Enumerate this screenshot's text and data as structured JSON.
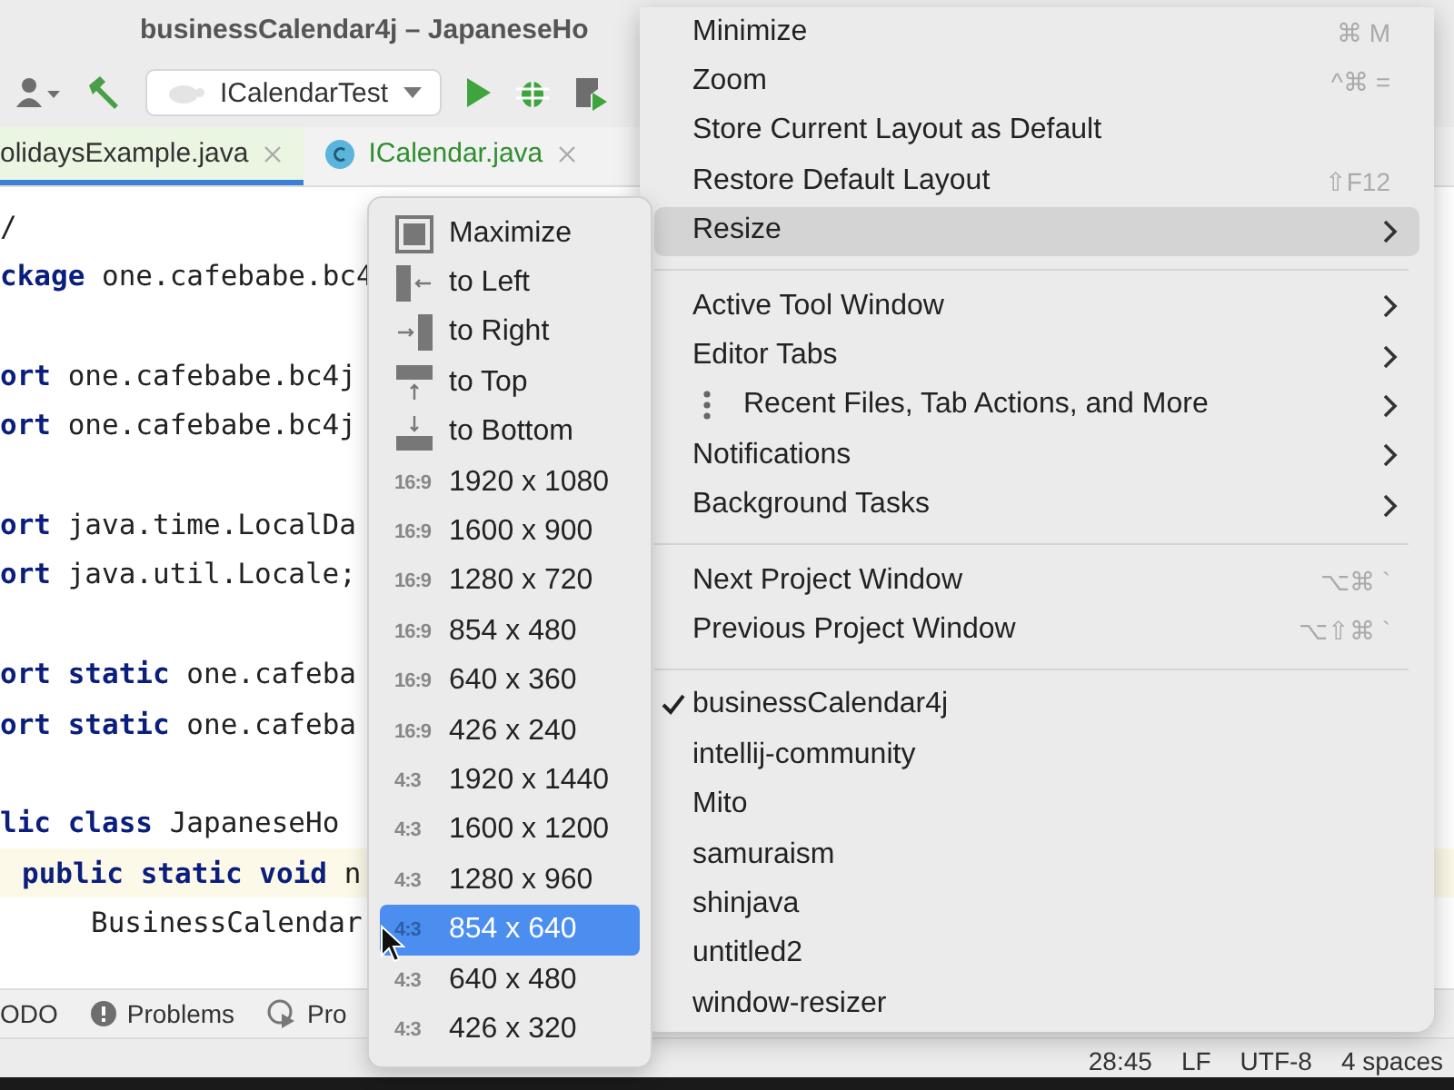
{
  "window": {
    "title": "businessCalendar4j – JapaneseHo"
  },
  "toolbar": {
    "run_configuration": "ICalendarTest"
  },
  "tabs": [
    {
      "label": "olidaysExample.java",
      "selected": true,
      "kind": "plain"
    },
    {
      "label": "ICalendar.java",
      "selected": false,
      "kind": "class"
    }
  ],
  "code_lines": [
    {
      "kind": "code",
      "text": "/"
    },
    {
      "kind": "code",
      "keyword": "ckage",
      "text": " one.cafebabe.bc4"
    },
    {
      "kind": "blank"
    },
    {
      "kind": "code",
      "keyword": "ort",
      "text": " one.cafebabe.bc4j"
    },
    {
      "kind": "code",
      "keyword": "ort",
      "text": " one.cafebabe.bc4j"
    },
    {
      "kind": "blank"
    },
    {
      "kind": "code",
      "keyword": "ort",
      "text": " java.time.LocalDa"
    },
    {
      "kind": "code",
      "keyword": "ort",
      "text": " java.util.Locale;"
    },
    {
      "kind": "blank"
    },
    {
      "kind": "code",
      "keyword": "ort static",
      "text": " one.cafeba"
    },
    {
      "kind": "code",
      "keyword": "ort static",
      "text": " one.cafeba"
    },
    {
      "kind": "blank"
    },
    {
      "kind": "code",
      "keyword": "lic class",
      "text": " JapaneseHo"
    },
    {
      "kind": "current",
      "keyword": "public static void",
      "text": " n"
    },
    {
      "kind": "nested",
      "text": "BusinessCalendar"
    }
  ],
  "tool_tabs": [
    {
      "label": "ODO",
      "kind": "plain"
    },
    {
      "label": "Problems",
      "kind": "problems"
    },
    {
      "label": "Pro",
      "kind": "profiler"
    }
  ],
  "status_bar": [
    "28:45",
    "LF",
    "UTF-8",
    "4 spaces"
  ],
  "resize_menu": [
    {
      "kind": "icon",
      "label": "Maximize",
      "selected": false
    },
    {
      "kind": "icon",
      "label": "to Left",
      "selected": false
    },
    {
      "kind": "icon",
      "label": "to Right",
      "selected": false
    },
    {
      "kind": "icon",
      "label": "to Top",
      "selected": false
    },
    {
      "kind": "icon",
      "label": "to Bottom",
      "selected": false
    },
    {
      "kind": "ratio",
      "ratio": "16:9",
      "label": "1920 x 1080",
      "selected": false
    },
    {
      "kind": "ratio",
      "ratio": "16:9",
      "label": "1600 x 900",
      "selected": false
    },
    {
      "kind": "ratio",
      "ratio": "16:9",
      "label": "1280 x 720",
      "selected": false
    },
    {
      "kind": "ratio",
      "ratio": "16:9",
      "label": "854 x 480",
      "selected": false
    },
    {
      "kind": "ratio",
      "ratio": "16:9",
      "label": "640 x 360",
      "selected": false
    },
    {
      "kind": "ratio",
      "ratio": "16:9",
      "label": "426 x 240",
      "selected": false
    },
    {
      "kind": "ratio",
      "ratio": "4:3",
      "label": "1920 x 1440",
      "selected": false
    },
    {
      "kind": "ratio",
      "ratio": "4:3",
      "label": "1600 x 1200",
      "selected": false
    },
    {
      "kind": "ratio",
      "ratio": "4:3",
      "label": "1280 x 960",
      "selected": false
    },
    {
      "kind": "ratio",
      "ratio": "4:3",
      "label": "854 x 640",
      "selected": true
    },
    {
      "kind": "ratio",
      "ratio": "4:3",
      "label": "640 x 480",
      "selected": false
    },
    {
      "kind": "ratio",
      "ratio": "4:3",
      "label": "426 x 320",
      "selected": false
    }
  ],
  "window_menu": [
    {
      "kind": "item",
      "label": "Minimize",
      "shortcut": "⌘ M",
      "submenu": false,
      "selected": false
    },
    {
      "kind": "item",
      "label": "Zoom",
      "shortcut": "^⌘ =",
      "submenu": false,
      "selected": false
    },
    {
      "kind": "item",
      "label": "Store Current Layout as Default",
      "submenu": false,
      "selected": false
    },
    {
      "kind": "item",
      "label": "Restore Default Layout",
      "shortcut": "⇧F12",
      "submenu": false,
      "selected": false
    },
    {
      "kind": "item",
      "label": "Resize",
      "submenu": true,
      "selected": true
    },
    {
      "kind": "separator"
    },
    {
      "kind": "item",
      "label": "Active Tool Window",
      "submenu": true,
      "selected": false
    },
    {
      "kind": "item",
      "label": "Editor Tabs",
      "submenu": true,
      "selected": false
    },
    {
      "kind": "more",
      "label": "Recent Files, Tab Actions, and More",
      "submenu": true,
      "selected": false
    },
    {
      "kind": "item",
      "label": "Notifications",
      "submenu": true,
      "selected": false
    },
    {
      "kind": "item",
      "label": "Background Tasks",
      "submenu": true,
      "selected": false
    },
    {
      "kind": "separator"
    },
    {
      "kind": "item",
      "label": "Next Project Window",
      "shortcut": "⌥⌘ `",
      "submenu": false,
      "selected": false
    },
    {
      "kind": "item",
      "label": "Previous Project Window",
      "shortcut": "⌥⇧⌘ `",
      "submenu": false,
      "selected": false
    },
    {
      "kind": "separator"
    },
    {
      "kind": "project",
      "label": "businessCalendar4j",
      "checked": true
    },
    {
      "kind": "project",
      "label": "intellij-community",
      "checked": false
    },
    {
      "kind": "project",
      "label": "Mito",
      "checked": false
    },
    {
      "kind": "project",
      "label": "samuraism",
      "checked": false
    },
    {
      "kind": "project",
      "label": "shinjava",
      "checked": false
    },
    {
      "kind": "project",
      "label": "untitled2",
      "checked": false
    },
    {
      "kind": "project",
      "label": "window-resizer",
      "checked": false
    }
  ]
}
